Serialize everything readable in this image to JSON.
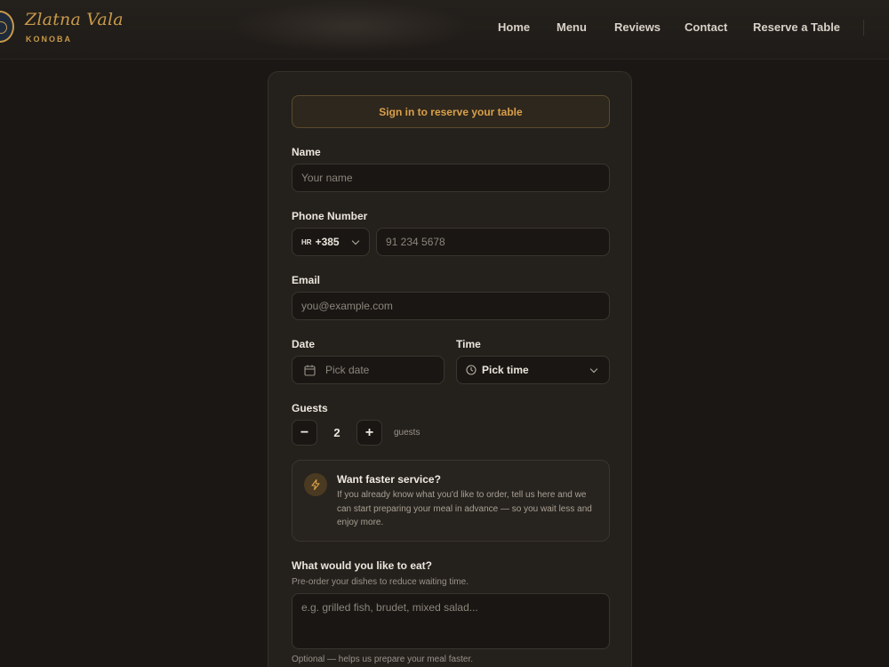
{
  "header": {
    "logo_name": "Zlatna Vala",
    "logo_sub": "KONOBA",
    "nav": [
      {
        "label": "Home"
      },
      {
        "label": "Menu"
      },
      {
        "label": "Reviews"
      },
      {
        "label": "Contact"
      },
      {
        "label": "Reserve a Table"
      }
    ]
  },
  "form": {
    "signin_banner": "Sign in to reserve your table",
    "name": {
      "label": "Name",
      "placeholder": "Your name",
      "value": ""
    },
    "phone": {
      "label": "Phone Number",
      "country_flag": "HR",
      "country_code": "+385",
      "placeholder": "91 234 5678",
      "value": ""
    },
    "email": {
      "label": "Email",
      "placeholder": "you@example.com",
      "value": ""
    },
    "date": {
      "label": "Date",
      "placeholder": "Pick date"
    },
    "time": {
      "label": "Time",
      "placeholder": "Pick time"
    },
    "guests": {
      "label": "Guests",
      "minus": "−",
      "plus": "+",
      "count": "2",
      "unit": "guests"
    },
    "faster_service": {
      "title": "Want faster service?",
      "text": "If you already know what you'd like to order, tell us here and we can start preparing your meal in advance — so you wait less and enjoy more."
    },
    "preorder": {
      "label": "What would you like to eat?",
      "subtitle": "Pre-order your dishes to reduce waiting time.",
      "placeholder": "e.g. grilled fish, brudet, mixed salad...",
      "hint": "Optional — helps us prepare your meal faster."
    }
  },
  "colors": {
    "accent": "#d9a04a",
    "background": "#1a1714",
    "card": "#24211d",
    "input_bg": "#191613"
  }
}
